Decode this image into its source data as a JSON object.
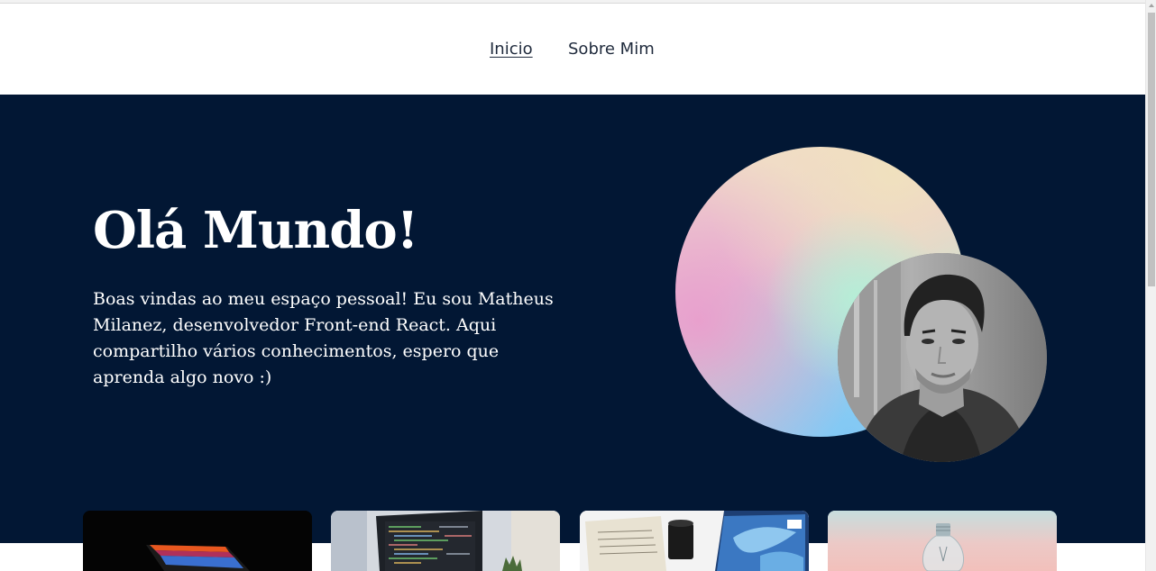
{
  "nav": {
    "items": [
      {
        "label": "Inicio",
        "active": true
      },
      {
        "label": "Sobre Mim",
        "active": false
      }
    ]
  },
  "hero": {
    "title": "Olá Mundo!",
    "text": "Boas vindas ao meu espaço pessoal! Eu sou Matheus Milanez, desenvolvedor Front-end React. Aqui compartilho vários conhecimentos, espero que aprenda algo novo :)"
  },
  "colors": {
    "hero_background": "#021734",
    "text_on_dark": "#ffffff",
    "nav_text": "#1f2a3c"
  },
  "cards": [
    {
      "image": "laptop-dark-photo"
    },
    {
      "image": "code-laptop-photo"
    },
    {
      "image": "desk-items-photo"
    },
    {
      "image": "lightbulb-photo"
    }
  ]
}
